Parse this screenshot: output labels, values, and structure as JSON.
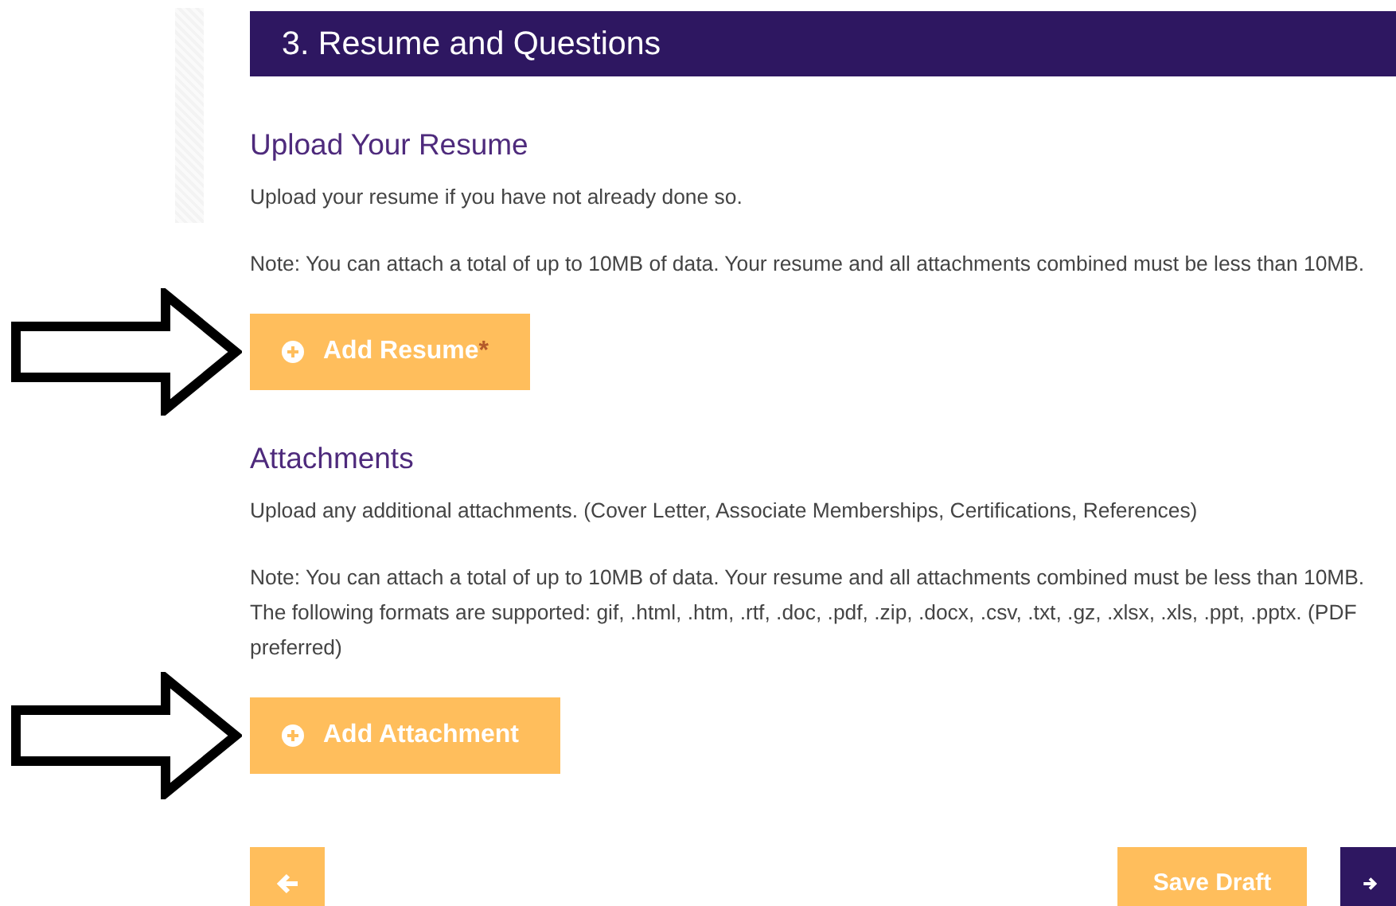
{
  "header": {
    "title": "3. Resume and Questions"
  },
  "sections": [
    {
      "title": "Upload Your Resume",
      "annotated": true,
      "paragraphs": [
        "Upload your resume if you have not already done so.",
        "Note: You can attach a total of up to 10MB of data. Your resume and all attachments combined must be less than 10MB."
      ],
      "button": {
        "label": "Add Resume",
        "required_mark": "*"
      }
    },
    {
      "title": "Attachments",
      "annotated": true,
      "paragraphs": [
        "Upload any additional attachments. (Cover Letter, Associate Memberships, Certifications, References)",
        "Note: You can attach a total of up to 10MB of data. Your resume and all attachments combined must be less than 10MB. The following formats are supported: gif, .html, .htm, .rtf, .doc, .pdf, .zip, .docx, .csv, .txt, .gz, .xlsx, .xls, .ppt, .pptx. (PDF preferred)"
      ],
      "button": {
        "label": "Add Attachment"
      }
    }
  ],
  "nav": {
    "save_label": "Save Draft"
  }
}
